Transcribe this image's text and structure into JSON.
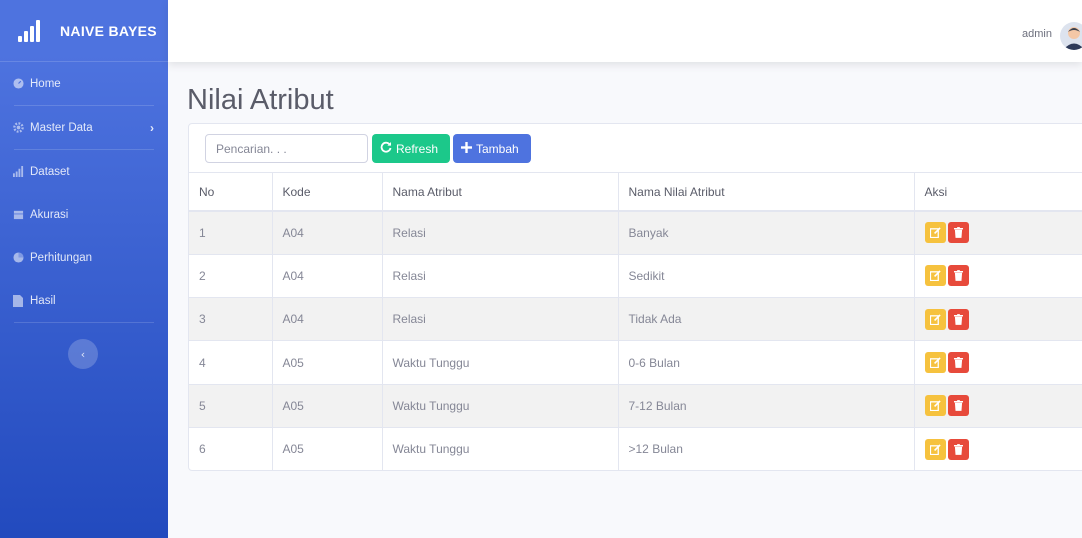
{
  "brand": {
    "name": "NAIVE BAYES"
  },
  "sidebar": {
    "items": [
      {
        "label": "Home",
        "icon": "dashboard-icon"
      },
      {
        "label": "Master Data",
        "icon": "cog-icon",
        "has_submenu": true
      },
      {
        "label": "Dataset",
        "icon": "bar-chart-icon"
      },
      {
        "label": "Akurasi",
        "icon": "calendar-icon"
      },
      {
        "label": "Perhitungan",
        "icon": "pie-chart-icon"
      },
      {
        "label": "Hasil",
        "icon": "file-icon"
      }
    ],
    "toggle_symbol": "‹"
  },
  "topbar": {
    "user_name": "admin"
  },
  "page": {
    "title": "Nilai Atribut"
  },
  "toolbar": {
    "search_placeholder": "Pencarian. . .",
    "refresh_label": "Refresh",
    "add_label": "Tambah"
  },
  "table": {
    "headers": [
      "No",
      "Kode",
      "Nama Atribut",
      "Nama Nilai Atribut",
      "Aksi"
    ],
    "rows": [
      {
        "no": "1",
        "kode": "A04",
        "nama": "Relasi",
        "nilai": "Banyak"
      },
      {
        "no": "2",
        "kode": "A04",
        "nama": "Relasi",
        "nilai": "Sedikit"
      },
      {
        "no": "3",
        "kode": "A04",
        "nama": "Relasi",
        "nilai": "Tidak Ada"
      },
      {
        "no": "4",
        "kode": "A05",
        "nama": "Waktu Tunggu",
        "nilai": "0-6 Bulan"
      },
      {
        "no": "5",
        "kode": "A05",
        "nama": "Waktu Tunggu",
        "nilai": "7-12 Bulan"
      },
      {
        "no": "6",
        "kode": "A05",
        "nama": "Waktu Tunggu",
        "nilai": ">12 Bulan"
      }
    ]
  },
  "colors": {
    "sidebar_top": "#4e73df",
    "sidebar_bottom": "#224abe",
    "refresh": "#1cc88a",
    "add": "#4e73df",
    "edit": "#f6c23e",
    "delete": "#e74a3b"
  }
}
